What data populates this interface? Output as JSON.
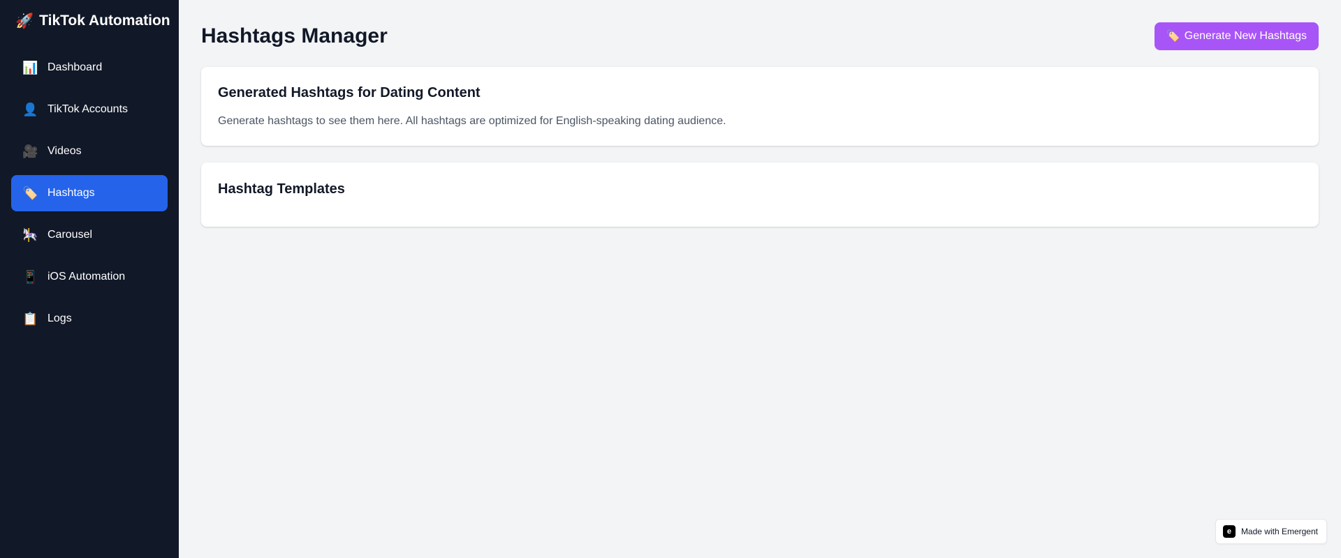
{
  "sidebar": {
    "brand": {
      "icon": "🚀",
      "title": "TikTok Automation"
    },
    "items": [
      {
        "icon": "📊",
        "label": "Dashboard"
      },
      {
        "icon": "👤",
        "label": "TikTok Accounts"
      },
      {
        "icon": "🎥",
        "label": "Videos"
      },
      {
        "icon": "🏷️",
        "label": "Hashtags",
        "active": true
      },
      {
        "icon": "🎠",
        "label": "Carousel"
      },
      {
        "icon": "📱",
        "label": "iOS Automation"
      },
      {
        "icon": "📋",
        "label": "Logs"
      }
    ]
  },
  "header": {
    "title": "Hashtags Manager",
    "generate_button": {
      "icon": "🏷️",
      "label": "Generate New Hashtags"
    }
  },
  "generated_card": {
    "title": "Generated Hashtags for Dating Content",
    "text": "Generate hashtags to see them here. All hashtags are optimized for English-speaking dating audience."
  },
  "templates_card": {
    "title": "Hashtag Templates"
  },
  "badge": {
    "label": "Made with Emergent"
  },
  "colors": {
    "sidebar_bg": "#111827",
    "active_item": "#2563eb",
    "generate_button": "#a855f7",
    "page_bg": "#f3f4f6"
  }
}
